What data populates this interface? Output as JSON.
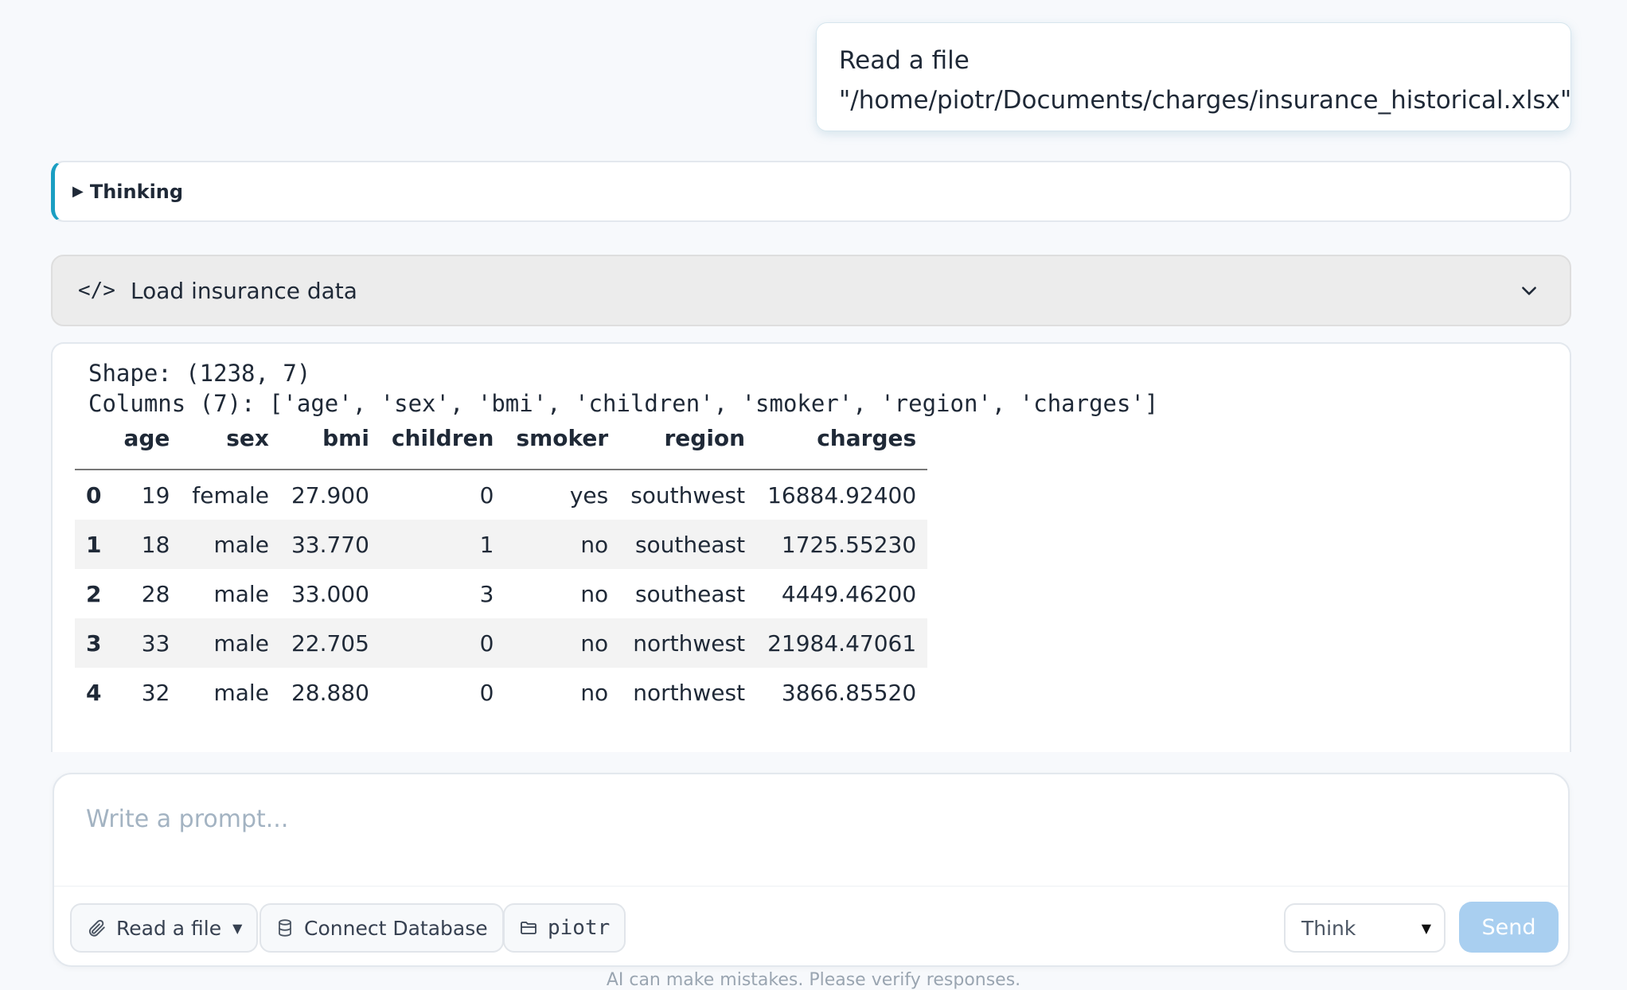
{
  "user_message": {
    "line1": "Read a file",
    "line2": "\"/home/piotr/Documents/charges/insurance_historical.xlsx\""
  },
  "thinking": {
    "label": "Thinking",
    "icon": "triangle-right-icon"
  },
  "tool_call": {
    "title": "Load insurance data",
    "icon": "code-icon",
    "toggle_icon": "chevron-down-icon"
  },
  "output": {
    "shape_line": "Shape: (1238, 7)",
    "columns_line": "Columns (7): ['age', 'sex', 'bmi', 'children', 'smoker', 'region', 'charges']",
    "table": {
      "headers": [
        "",
        "age",
        "sex",
        "bmi",
        "children",
        "smoker",
        "region",
        "charges"
      ],
      "rows": [
        [
          "0",
          "19",
          "female",
          "27.900",
          "0",
          "yes",
          "southwest",
          "16884.92400"
        ],
        [
          "1",
          "18",
          "male",
          "33.770",
          "1",
          "no",
          "southeast",
          "1725.55230"
        ],
        [
          "2",
          "28",
          "male",
          "33.000",
          "3",
          "no",
          "southeast",
          "4449.46200"
        ],
        [
          "3",
          "33",
          "male",
          "22.705",
          "0",
          "no",
          "northwest",
          "21984.47061"
        ],
        [
          "4",
          "32",
          "male",
          "28.880",
          "0",
          "no",
          "northwest",
          "3866.85520"
        ]
      ]
    }
  },
  "composer": {
    "placeholder": "Write a prompt...",
    "read_file_label": "Read a file",
    "connect_db_label": "Connect Database",
    "folder_label": "piotr",
    "mode_label": "Think",
    "send_label": "Send"
  },
  "disclaimer": "AI can make mistakes. Please verify responses.",
  "colors": {
    "accent": "#1a9ec2",
    "send_disabled": "#a9cff0"
  }
}
